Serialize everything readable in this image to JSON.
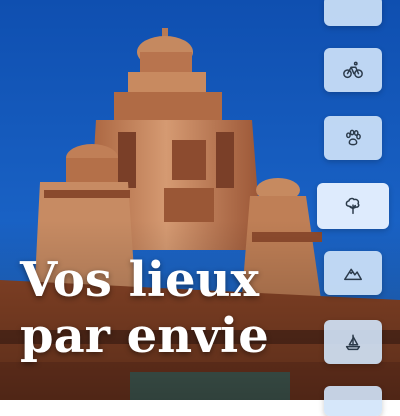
{
  "headline": {
    "line1": "Vos lieux",
    "line2": "par envie"
  },
  "categories": [
    {
      "icon": "blank-icon",
      "active": false
    },
    {
      "icon": "bicycle-icon",
      "active": false
    },
    {
      "icon": "paw-icon",
      "active": false
    },
    {
      "icon": "tree-icon",
      "active": true
    },
    {
      "icon": "mountain-icon",
      "active": false
    },
    {
      "icon": "sailboat-icon",
      "active": false
    },
    {
      "icon": "blank-icon",
      "active": false
    }
  ],
  "colors": {
    "sky": "#1a5fbf",
    "tower": "#c9875f",
    "button": "#d2e4fa",
    "icon": "#2b3a4a"
  }
}
